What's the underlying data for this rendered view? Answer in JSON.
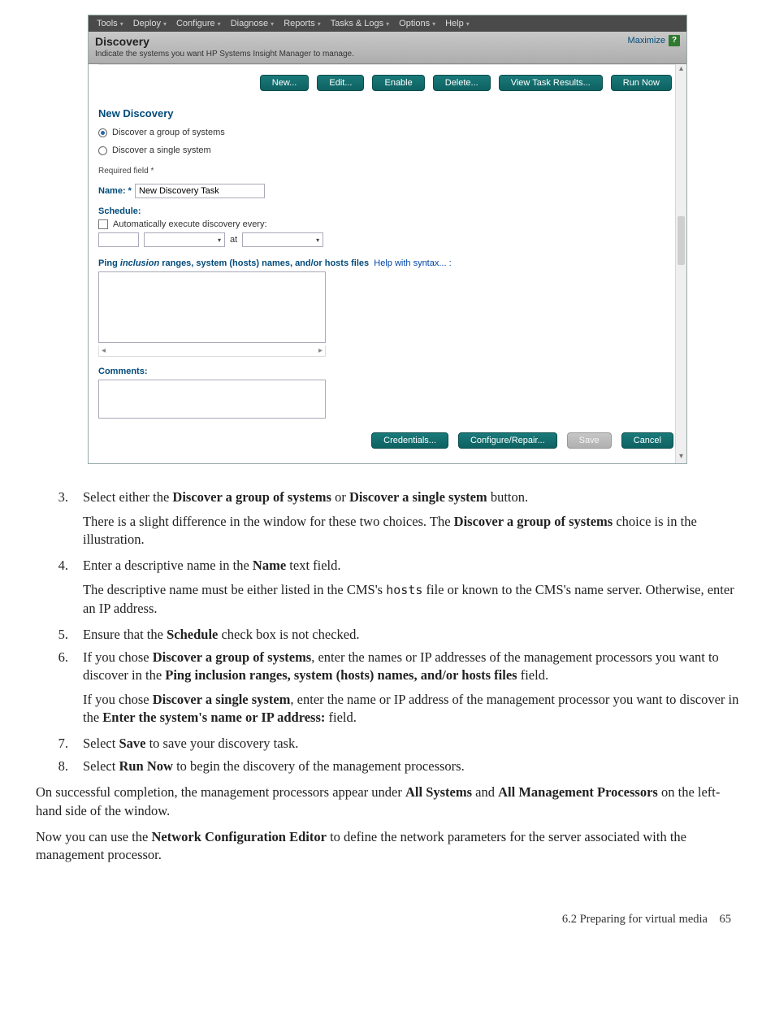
{
  "app": {
    "menubar": [
      "Tools",
      "Deploy",
      "Configure",
      "Diagnose",
      "Reports",
      "Tasks & Logs",
      "Options",
      "Help"
    ],
    "title": "Discovery",
    "subtitle": "Indicate the systems you want HP Systems Insight Manager to manage.",
    "maximize": "Maximize",
    "help_icon": "?",
    "top_buttons": [
      "New...",
      "Edit...",
      "Enable",
      "Delete...",
      "View Task Results...",
      "Run Now"
    ],
    "section_title": "New Discovery",
    "radio_options": [
      "Discover a group of systems",
      "Discover a single system"
    ],
    "radio_selected": 0,
    "required_text": "Required field *",
    "name_label": "Name: *",
    "name_value": "New Discovery Task",
    "schedule_label": "Schedule:",
    "schedule_checkbox_label": "Automatically execute discovery every:",
    "schedule_at": "at",
    "ping_label_prefix": "Ping ",
    "ping_label_em": "inclusion",
    "ping_label_rest": " ranges, system (hosts) names, and/or hosts files",
    "ping_help_link": "Help with syntax... :",
    "comments_label": "Comments:",
    "bottom_buttons": {
      "credentials": "Credentials...",
      "configure": "Configure/Repair...",
      "save": "Save",
      "cancel": "Cancel"
    }
  },
  "doc": {
    "step3_a": "Select either the ",
    "step3_b1": "Discover a group of systems",
    "step3_or": " or ",
    "step3_b2": "Discover a single system",
    "step3_c": " button.",
    "step3_p_a": "There is a slight difference in the window for these two choices. The ",
    "step3_p_b": "Discover a group of systems",
    "step3_p_c": " choice is in the illustration.",
    "step4_a": "Enter a descriptive name in the ",
    "step4_b": "Name",
    "step4_c": " text field.",
    "step4_p_a": "The descriptive name must be either listed in the CMS's ",
    "step4_code": "hosts",
    "step4_p_b": " file or known to the CMS's name server. Otherwise, enter an IP address.",
    "step5_a": "Ensure that the ",
    "step5_b": "Schedule",
    "step5_c": " check box is not checked.",
    "step6_a": "If you chose ",
    "step6_b1": "Discover a group of systems",
    "step6_mid": ", enter the names or IP addresses of the management processors you want to discover in the ",
    "step6_b2": "Ping inclusion ranges, system (hosts) names, and/or hosts files",
    "step6_c": " field.",
    "step6_p_a": "If you chose ",
    "step6_p_b1": "Discover a single system",
    "step6_p_mid": ", enter the name or IP address of the management processor you want to discover in the ",
    "step6_p_b2": "Enter the system's name or IP address:",
    "step6_p_c": " field.",
    "step7_a": "Select ",
    "step7_b": "Save",
    "step7_c": " to save your discovery task.",
    "step8_a": "Select ",
    "step8_b": "Run Now",
    "step8_c": " to begin the discovery of the management processors.",
    "para1_a": "On successful completion, the management processors appear under ",
    "para1_b1": "All Systems",
    "para1_and": " and ",
    "para1_b2": "All Management Processors",
    "para1_c": " on the left-hand side of the window.",
    "para2_a": "Now you can use the ",
    "para2_b": "Network Configuration Editor",
    "para2_c": " to define the network parameters for the server associated with the management processor.",
    "nums": {
      "n3": "3.",
      "n4": "4.",
      "n5": "5.",
      "n6": "6.",
      "n7": "7.",
      "n8": "8."
    }
  },
  "footer": {
    "section": "6.2 Preparing for virtual media",
    "page": "65"
  }
}
